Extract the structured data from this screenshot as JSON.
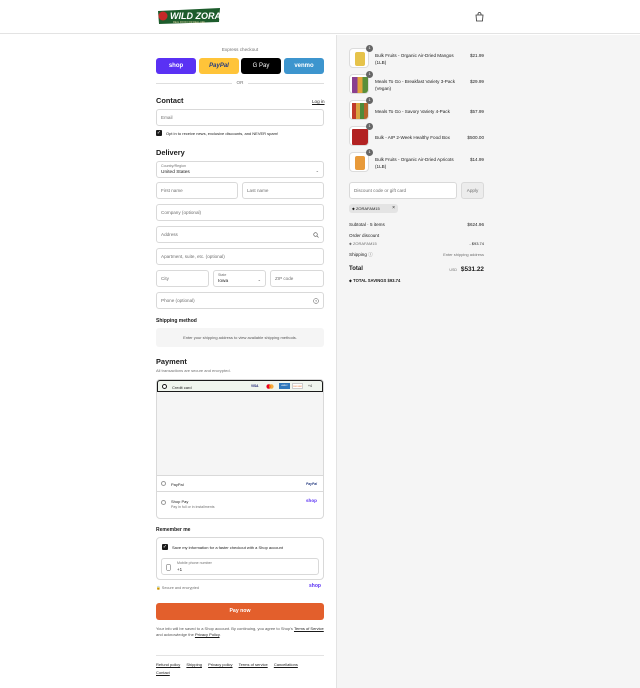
{
  "brand": {
    "logo_text": "WILD ZORA",
    "logo_tagline": "REAL FOOD FOR REAL LIFE",
    "accent": "#1d5c2c",
    "primary_button": "#e35f2c"
  },
  "express": {
    "label": "Express checkout",
    "buttons": [
      {
        "label": "shop",
        "bg": "#5a31f4",
        "fg": "#ffffff"
      },
      {
        "label": "PayPal",
        "bg": "#ffc439",
        "fg": "#253b80"
      },
      {
        "label": "G Pay",
        "bg": "#000000",
        "fg": "#ffffff"
      },
      {
        "label": "venmo",
        "bg": "#3d95ce",
        "fg": "#ffffff"
      }
    ],
    "or": "OR"
  },
  "contact": {
    "title": "Contact",
    "login": "Log in",
    "email_placeholder": "Email",
    "optin": "Opt in to receive news, exclusive discounts, and NEVER spam!"
  },
  "delivery": {
    "title": "Delivery",
    "country_label": "Country/Region",
    "country_value": "United States",
    "first_name": "First name",
    "last_name": "Last name",
    "company": "Company (optional)",
    "address": "Address",
    "apartment": "Apartment, suite, etc. (optional)",
    "city": "City",
    "state_label": "State",
    "state_value": "Iowa",
    "zip": "ZIP code",
    "phone": "Phone (optional)"
  },
  "shipping_method": {
    "title": "Shipping method",
    "note": "Enter your shipping address to view available shipping methods."
  },
  "payment": {
    "title": "Payment",
    "subtitle": "All transactions are secure and encrypted.",
    "credit_card": "Credit card",
    "card_brands": [
      "VISA",
      "MC",
      "AMEX",
      "DISCOVER",
      "+4"
    ],
    "paypal": "PayPal",
    "paypal_logo": "PayPal",
    "shop_pay": "Shop Pay",
    "shop_pay_sub": "Pay in full or in installments",
    "shop_logo": "shop"
  },
  "remember": {
    "title": "Remember me",
    "save_info": "Save my information for a faster checkout with a Shop account",
    "phone_label": "Mobile phone number",
    "phone_value": "+1",
    "secure": "Secure and encrypted",
    "shop_logo": "shop"
  },
  "pay_now": "Pay now",
  "disclaimer": {
    "text1": "Your info will be saved to a Shop account. By continuing, you agree to Shop's",
    "terms": "Terms of Service",
    "text2": "and acknowledge the",
    "privacy": "Privacy Policy",
    "end": "."
  },
  "footer_links": [
    "Refund policy",
    "Shipping",
    "Privacy policy",
    "Terms of service",
    "Cancellations",
    "Contact"
  ],
  "items": [
    {
      "qty": "1",
      "name": "Bulk Fruits - Organic Air-Dried Mangos (1LB)",
      "price": "$21.99",
      "color": "#e6c34a"
    },
    {
      "qty": "1",
      "name": "Meals To Go - Breakfast Variety 3-Pack (Vegan)",
      "price": "$29.99",
      "color": "#8a3f8f"
    },
    {
      "qty": "1",
      "name": "Meals To Go - Savory Variety 4-Pack",
      "price": "$57.99",
      "color": "#c0392b"
    },
    {
      "qty": "1",
      "name": "Bulk - AIP 2-Week Healthy Food Box",
      "price": "$500.00",
      "color": "#b22222"
    },
    {
      "qty": "1",
      "name": "Bulk Fruits - Organic Air-Dried Apricots (1LB)",
      "price": "$14.99",
      "color": "#e89a3a"
    }
  ],
  "discount": {
    "placeholder": "Discount code or gift card",
    "apply": "Apply",
    "applied_code": "ZORAFAM15"
  },
  "summary": {
    "subtotal_label": "Subtotal · 5 items",
    "subtotal_value": "$624.96",
    "order_discount_label": "Order discount",
    "discount_code": "ZORAFAM15",
    "discount_value": "- $93.74",
    "shipping_label": "Shipping",
    "shipping_value": "Enter shipping address",
    "total_label": "Total",
    "currency": "USD",
    "total_value": "$531.22",
    "savings_label": "TOTAL SAVINGS",
    "savings_value": "$93.74"
  }
}
